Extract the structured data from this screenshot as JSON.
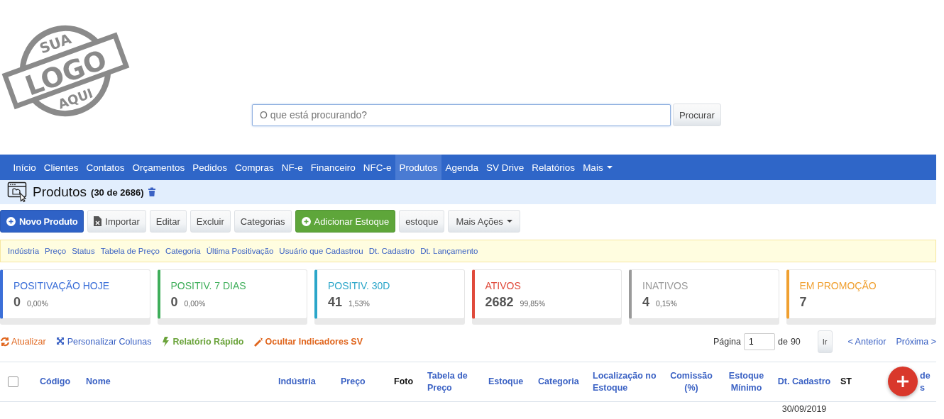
{
  "logo": {
    "top": "SUA",
    "main": "LOGO",
    "bottom": "AQUI"
  },
  "search": {
    "placeholder": "O que está procurando?",
    "button": "Procurar"
  },
  "nav": [
    {
      "label": "Início",
      "selected": false,
      "caret": false
    },
    {
      "label": "Clientes",
      "selected": false,
      "caret": false
    },
    {
      "label": "Contatos",
      "selected": false,
      "caret": false
    },
    {
      "label": "Orçamentos",
      "selected": false,
      "caret": false
    },
    {
      "label": "Pedidos",
      "selected": false,
      "caret": false
    },
    {
      "label": "Compras",
      "selected": false,
      "caret": false
    },
    {
      "label": "NF-e",
      "selected": false,
      "caret": false
    },
    {
      "label": "Financeiro",
      "selected": false,
      "caret": false
    },
    {
      "label": "NFC-e",
      "selected": false,
      "caret": false
    },
    {
      "label": "Produtos",
      "selected": true,
      "caret": false
    },
    {
      "label": "Agenda",
      "selected": false,
      "caret": false
    },
    {
      "label": "SV Drive",
      "selected": false,
      "caret": false
    },
    {
      "label": "Relatórios",
      "selected": false,
      "caret": false
    },
    {
      "label": "Mais",
      "selected": false,
      "caret": true
    }
  ],
  "page_title": {
    "title": "Produtos",
    "count": "(30 de 2686)"
  },
  "actions": [
    {
      "label": "Novo Produto",
      "kind": "primary"
    },
    {
      "label": "Importar",
      "kind": "import"
    },
    {
      "label": "Editar",
      "kind": "plain"
    },
    {
      "label": "Excluir",
      "kind": "plain"
    },
    {
      "label": "Categorias",
      "kind": "plain"
    },
    {
      "label": "Adicionar Estoque",
      "kind": "success"
    },
    {
      "label": "estoque",
      "kind": "plain"
    },
    {
      "label": "Mais Ações",
      "kind": "dropdown"
    }
  ],
  "filters": [
    "Indústria",
    "Preço",
    "Status",
    "Tabela de Preço",
    "Categoria",
    "Última Positivação",
    "Usuário que Cadastrou",
    "Dt. Cadastro",
    "Dt. Lançamento"
  ],
  "indicators": [
    {
      "label": "POSITIVAÇÃO HOJE",
      "value": "0",
      "percent": "0,00%",
      "color": "#3b6fd8"
    },
    {
      "label": "POSITIV. 7 DIAS",
      "value": "0",
      "percent": "0,00%",
      "color": "#3fae5a"
    },
    {
      "label": "POSITIV. 30D",
      "value": "41",
      "percent": "1,53%",
      "color": "#2ba6c9"
    },
    {
      "label": "ATIVOS",
      "value": "2682",
      "percent": "99,85%",
      "color": "#e04a3b"
    },
    {
      "label": "INATIVOS",
      "value": "4",
      "percent": "0,15%",
      "color": "#9a9a9a"
    },
    {
      "label": "EM PROMOÇÃO",
      "value": "7",
      "color": "#f0a030"
    }
  ],
  "tools": [
    {
      "label": "Atualizar",
      "kind": "refresh"
    },
    {
      "label": "Personalizar Colunas",
      "kind": "columns"
    },
    {
      "label": "Relatório Rápido",
      "kind": "report"
    },
    {
      "label": "Ocultar Indicadores SV",
      "kind": "hide"
    }
  ],
  "pagination": {
    "label": "Página",
    "page": "1",
    "of": "de",
    "total": "90",
    "go": "Ir",
    "prev": "< Anterior",
    "next": "Próxima >"
  },
  "table": {
    "select_all": {
      "checked": false
    },
    "columns": [
      {
        "label": "Código",
        "sortable": true
      },
      {
        "label": "Nome",
        "sortable": true
      },
      {
        "label": "Indústria",
        "sortable": true
      },
      {
        "label": "Preço",
        "sortable": true
      },
      {
        "label": "Foto",
        "sortable": false
      },
      {
        "label": "Tabela de Preço",
        "sortable": true
      },
      {
        "label": "Estoque",
        "sortable": true
      },
      {
        "label": "Categoria",
        "sortable": true
      },
      {
        "label": "Localização no Estoque",
        "sortable": true
      },
      {
        "label": "Comissão (%)",
        "sortable": true
      },
      {
        "label": "Estoque Mínimo",
        "sortable": true
      },
      {
        "label": "Dt. Cadastro",
        "sortable": true
      },
      {
        "label": "ST",
        "sortable": false
      },
      {
        "label": "de\ns",
        "sortable": true
      }
    ],
    "rows": [
      {
        "dt_cadastro": "30/09/2019"
      }
    ]
  }
}
